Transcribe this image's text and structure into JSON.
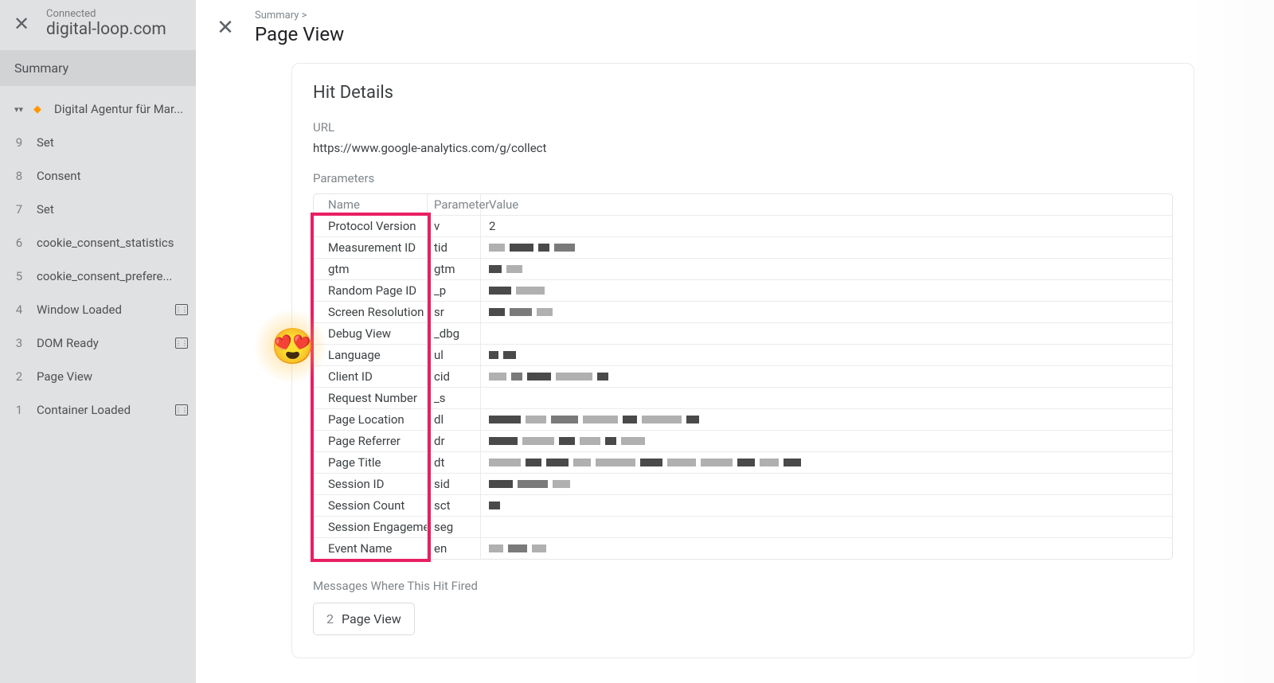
{
  "sidebar": {
    "connected_label": "Connected",
    "domain": "digital-loop.com",
    "summary_label": "Summary",
    "items": [
      {
        "idx": "",
        "label": "Digital Agentur für Mar...",
        "active": true,
        "expanded": true,
        "api": false
      },
      {
        "idx": "9",
        "label": "Set",
        "api": false
      },
      {
        "idx": "8",
        "label": "Consent",
        "api": false
      },
      {
        "idx": "7",
        "label": "Set",
        "api": false
      },
      {
        "idx": "6",
        "label": "cookie_consent_statistics",
        "api": false
      },
      {
        "idx": "5",
        "label": "cookie_consent_prefere...",
        "api": false
      },
      {
        "idx": "4",
        "label": "Window Loaded",
        "api": true
      },
      {
        "idx": "3",
        "label": "DOM Ready",
        "api": true
      },
      {
        "idx": "2",
        "label": "Page View",
        "api": false
      },
      {
        "idx": "1",
        "label": "Container Loaded",
        "api": true
      }
    ]
  },
  "detail": {
    "breadcrumb": "Summary >",
    "title": "Page View",
    "card_title": "Hit Details",
    "url_label": "URL",
    "url_value": "https://www.google-analytics.com/g/collect",
    "parameters_label": "Parameters",
    "columns": {
      "name": "Name",
      "param": "Parameter",
      "value": "Value"
    },
    "rows": [
      {
        "name": "Protocol Version",
        "param": "v",
        "value": "2",
        "redact": []
      },
      {
        "name": "Measurement ID",
        "param": "tid",
        "value": "",
        "redact": [
          [
            20,
            "light"
          ],
          [
            30,
            "dark"
          ],
          [
            14,
            "dark"
          ],
          [
            26,
            "mid"
          ]
        ]
      },
      {
        "name": "gtm",
        "param": "gtm",
        "value": "",
        "redact": [
          [
            16,
            "dark"
          ],
          [
            20,
            "light"
          ]
        ]
      },
      {
        "name": "Random Page ID",
        "param": "_p",
        "value": "",
        "redact": [
          [
            28,
            "dark"
          ],
          [
            36,
            "light"
          ]
        ]
      },
      {
        "name": "Screen Resolution",
        "param": "sr",
        "value": "",
        "redact": [
          [
            20,
            "dark"
          ],
          [
            28,
            "mid"
          ],
          [
            20,
            "light"
          ]
        ]
      },
      {
        "name": "Debug View",
        "param": "_dbg",
        "value": "",
        "redact": []
      },
      {
        "name": "Language",
        "param": "ul",
        "value": "",
        "redact": [
          [
            12,
            "dark"
          ],
          [
            16,
            "dark"
          ]
        ]
      },
      {
        "name": "Client ID",
        "param": "cid",
        "value": "",
        "redact": [
          [
            22,
            "light"
          ],
          [
            14,
            "mid"
          ],
          [
            30,
            "dark"
          ],
          [
            46,
            "light"
          ],
          [
            14,
            "dark"
          ]
        ]
      },
      {
        "name": "Request Number",
        "param": "_s",
        "value": "",
        "redact": []
      },
      {
        "name": "Page Location",
        "param": "dl",
        "value": "",
        "redact": [
          [
            40,
            "dark"
          ],
          [
            26,
            "light"
          ],
          [
            34,
            "mid"
          ],
          [
            44,
            "light"
          ],
          [
            18,
            "dark"
          ],
          [
            50,
            "light"
          ],
          [
            16,
            "dark"
          ]
        ]
      },
      {
        "name": "Page Referrer",
        "param": "dr",
        "value": "",
        "redact": [
          [
            36,
            "dark"
          ],
          [
            40,
            "light"
          ],
          [
            20,
            "dark"
          ],
          [
            26,
            "light"
          ],
          [
            14,
            "dark"
          ],
          [
            30,
            "light"
          ]
        ]
      },
      {
        "name": "Page Title",
        "param": "dt",
        "value": "",
        "redact": [
          [
            40,
            "light"
          ],
          [
            20,
            "dark"
          ],
          [
            28,
            "dark"
          ],
          [
            22,
            "light"
          ],
          [
            50,
            "light"
          ],
          [
            28,
            "dark"
          ],
          [
            36,
            "light"
          ],
          [
            40,
            "light"
          ],
          [
            22,
            "dark"
          ],
          [
            24,
            "light"
          ],
          [
            22,
            "dark"
          ]
        ]
      },
      {
        "name": "Session ID",
        "param": "sid",
        "value": "",
        "redact": [
          [
            30,
            "dark"
          ],
          [
            38,
            "mid"
          ],
          [
            22,
            "light"
          ]
        ]
      },
      {
        "name": "Session Count",
        "param": "sct",
        "value": "",
        "redact": [
          [
            14,
            "dark"
          ]
        ]
      },
      {
        "name": "Session Engagement",
        "param": "seg",
        "value": "",
        "redact": []
      },
      {
        "name": "Event Name",
        "param": "en",
        "value": "",
        "redact": [
          [
            18,
            "light"
          ],
          [
            24,
            "mid"
          ],
          [
            18,
            "light"
          ]
        ]
      }
    ],
    "messages_label": "Messages Where This Hit Fired",
    "messages": [
      {
        "idx": "2",
        "label": "Page View"
      }
    ]
  }
}
